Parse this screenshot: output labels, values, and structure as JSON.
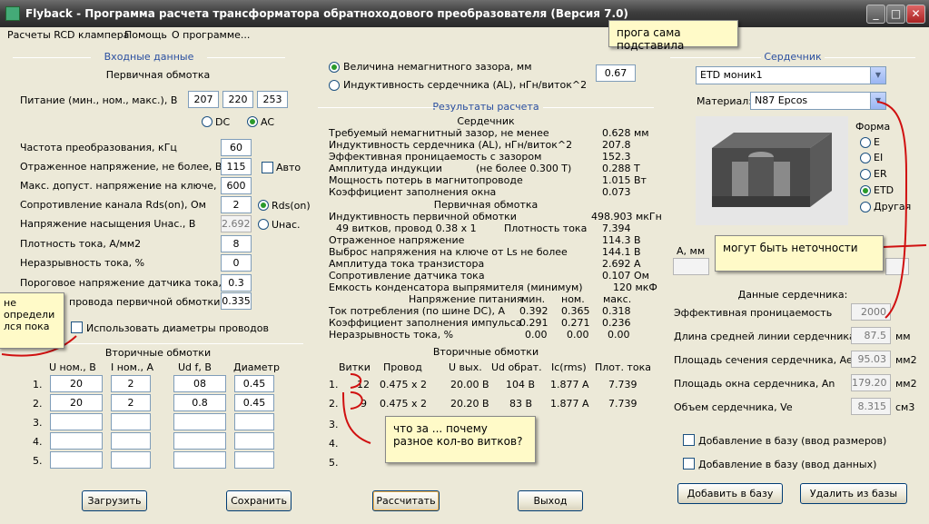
{
  "window": {
    "title": "Flyback - Программа расчета трансформатора обратноходового преобразователя (Версия 7.0)"
  },
  "menu": [
    "Расчеты RCD клампера",
    "Помощь",
    "О программе..."
  ],
  "input": {
    "group_title": "Входные данные",
    "primary_title": "Первичная обмотка",
    "supply_label": "Питание (мин., ном., макс.), В",
    "supply": [
      "207",
      "220",
      "253"
    ],
    "dc_label": "DC",
    "ac_label": "AC",
    "rows": [
      {
        "label": "Частота преобразования, кГц",
        "value": "60"
      },
      {
        "label": "Отраженное напряжение, не более, В",
        "value": "115"
      },
      {
        "label": "Макс. допуст. напряжение на ключе, В",
        "value": "600"
      },
      {
        "label": "Сопротивление канала Rds(on), Ом",
        "value": "2"
      },
      {
        "label": "Напряжение насыщения Uнас., В",
        "value": "2.692"
      },
      {
        "label": "Плотность тока, А/мм2",
        "value": "8"
      },
      {
        "label": "Неразрывность тока, %",
        "value": "0"
      },
      {
        "label": "Пороговое напряжение датчика тока, В",
        "value": "0.3"
      },
      {
        "label": "проводa первичной обмотки",
        "value": "0.335"
      }
    ],
    "auto_label": "Авто",
    "rds_label": "Rds(on)",
    "usat_label": "Uнас.",
    "use_diam_label": "Использовать диаметры проводов",
    "secondary_title": "Вторичные обмотки",
    "sec_headers": [
      "U ном., В",
      "I ном., А",
      "Ud f, В",
      "Диаметр"
    ],
    "sec_rows": [
      {
        "n": "1.",
        "u": "20",
        "i": "2",
        "ud": "08",
        "d": "0.45"
      },
      {
        "n": "2.",
        "u": "20",
        "i": "2",
        "ud": "0.8",
        "d": "0.45"
      },
      {
        "n": "3.",
        "u": "",
        "i": "",
        "ud": "",
        "d": ""
      },
      {
        "n": "4.",
        "u": "",
        "i": "",
        "ud": "",
        "d": ""
      },
      {
        "n": "5.",
        "u": "",
        "i": "",
        "ud": "",
        "d": ""
      }
    ]
  },
  "gap": {
    "opt1": "Величина немагнитного зазора, мм",
    "opt2": "Индуктивность сердечника (AL), нГн/виток^2",
    "value": "0.67"
  },
  "results": {
    "title": "Результаты расчета",
    "core_title": "Сердечник",
    "core_rows": [
      {
        "label": "Требуемый немагнитный зазор, не менее",
        "value": "0.628 мм"
      },
      {
        "label": "Индуктивность сердечника (AL), нГн/виток^2",
        "value": "207.8"
      },
      {
        "label": "Эффективная проницаемость с зазором",
        "value": "152.3"
      },
      {
        "label": "Амплитуда индукции",
        "mid": "(не более 0.300 Т)",
        "value": "0.288 Т"
      },
      {
        "label": "Мощность потерь в магнитопроводе",
        "value": "1.015 Вт"
      },
      {
        "label": "Коэффициент заполнения окна",
        "value": "0.073"
      }
    ],
    "primary_title": "Первичная обмотка",
    "prim_rows": [
      {
        "label": "Индуктивность первичной обмотки",
        "value": "498.903 мкГн"
      },
      {
        "label": "49 витков, провод 0.38 x 1",
        "mid": "Плотность тока",
        "value": "7.394"
      },
      {
        "label": "Отраженное напряжение",
        "value": "114.3 В"
      },
      {
        "label": "Выброс напряжения на ключе от Ls не более",
        "value": "144.1 В"
      },
      {
        "label": "Амплитуда тока транзистора",
        "value": "2.692 А"
      },
      {
        "label": "Сопротивление датчика тока",
        "value": "0.107 Ом"
      },
      {
        "label": "Емкость конденсатора выпрямителя (минимум)",
        "value": "120 мкФ"
      }
    ],
    "supply_hdr": [
      "Напряжение питания",
      "мин.",
      "ном.",
      "макс."
    ],
    "supply_rows": [
      {
        "label": "Ток потребления (по шине DC), А",
        "v": [
          "0.392",
          "0.365",
          "0.318"
        ]
      },
      {
        "label": "Коэффициент заполнения импульса",
        "v": [
          "0.291",
          "0.271",
          "0.236"
        ]
      },
      {
        "label": "Неразрывность тока, %",
        "v": [
          "0.00",
          "0.00",
          "0.00"
        ]
      }
    ],
    "secondary_title": "Вторичные обмотки",
    "sec_headers": [
      "Витки",
      "Провод",
      "U вых.",
      "Ud обрат.",
      "Ic(rms)",
      "Плот. тока"
    ],
    "sec_rows": [
      {
        "n": "1.",
        "t": "12",
        "w": "0.475 x 2",
        "u": "20.00 В",
        "ud": "104 В",
        "ic": "1.877 А",
        "j": "7.739"
      },
      {
        "n": "2.",
        "t": "9",
        "w": "0.475 x 2",
        "u": "20.20 В",
        "ud": "83 В",
        "ic": "1.877 А",
        "j": "7.739"
      },
      {
        "n": "3."
      },
      {
        "n": "4."
      },
      {
        "n": "5."
      }
    ]
  },
  "core": {
    "group_title": "Сердечник",
    "core_select": "ETD моник1",
    "material_label": "Материал:",
    "material": "N87 Epcos",
    "shape_title": "Форма",
    "shapes": [
      "E",
      "EI",
      "ER",
      "ETD",
      "Другая"
    ],
    "shape_selected": "ETD",
    "dims_label": "А, мм",
    "data_title": "Данные сердечника:",
    "data_rows": [
      {
        "label": "Эффективная проницаемость",
        "value": "2000",
        "unit": ""
      },
      {
        "label": "Длина средней линии сердечника, le",
        "value": "87.5",
        "unit": "мм"
      },
      {
        "label": "Площадь сечения сердечника, Ae",
        "value": "95.03",
        "unit": "мм2"
      },
      {
        "label": "Площадь окна сердечника, An",
        "value": "179.20",
        "unit": "мм2"
      },
      {
        "label": "Объем сердечника, Ve",
        "value": "8.315",
        "unit": "см3"
      }
    ],
    "add_size": "Добавление в базу (ввод размеров)",
    "add_data": "Добавление в базу (ввод данных)",
    "add_btn": "Добавить в базу",
    "del_btn": "Удалить из базы"
  },
  "buttons": {
    "load": "Загрузить",
    "save": "Сохранить",
    "calc": "Рассчитать",
    "exit": "Выход"
  },
  "notes": {
    "n1": "прога сама подставила",
    "n2": "могут быть неточности",
    "n3": "что за ... почему разное кол-во витков?",
    "n4": "не определи лся пока"
  },
  "colors": {
    "accent": "#2a4fa0",
    "note_bg": "#fffac8",
    "marker": "#d01010"
  }
}
